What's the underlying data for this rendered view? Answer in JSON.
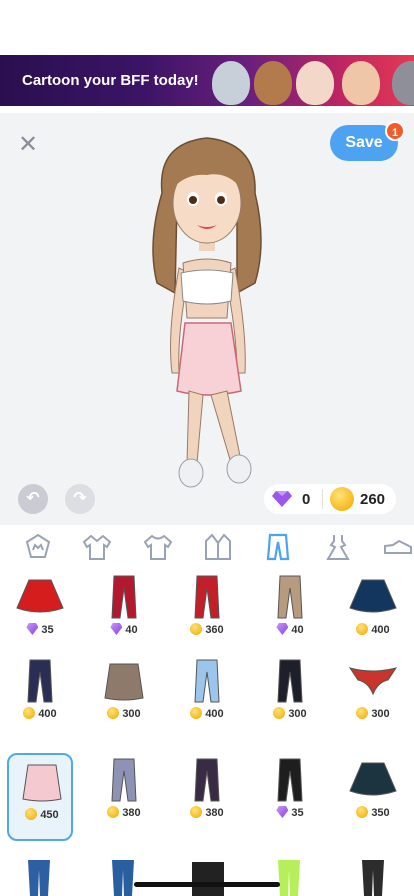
{
  "ad": {
    "text": "Cartoon your BFF today!"
  },
  "header": {
    "save_label": "Save",
    "save_badge": "1"
  },
  "wallet": {
    "gems": "0",
    "coins": "260"
  },
  "categories": [
    "crown-icon",
    "jacket-icon",
    "shirt-icon",
    "coat-icon",
    "pants-icon",
    "dress-icon",
    "shoe-icon"
  ],
  "active_category": "pants-icon",
  "colors": {
    "accent": "#4da3f2",
    "badge": "#f25a2a",
    "stage": "#f2f3f5"
  },
  "items": [
    {
      "name": "red-skirt",
      "price": "35",
      "currency": "gem",
      "color": "#d61d1d",
      "shape": "skirt"
    },
    {
      "name": "red-plaid-pants",
      "price": "40",
      "currency": "gem",
      "color": "#b3182e",
      "shape": "pants"
    },
    {
      "name": "red-pants",
      "price": "360",
      "currency": "coin",
      "color": "#c21f2a",
      "shape": "pants"
    },
    {
      "name": "tan-pants",
      "price": "40",
      "currency": "gem",
      "color": "#b69b7f",
      "shape": "pants"
    },
    {
      "name": "navy-skirt",
      "price": "400",
      "currency": "coin",
      "color": "#12365e",
      "shape": "skirt"
    },
    {
      "name": "navy-pants",
      "price": "400",
      "currency": "coin",
      "color": "#2a2e55",
      "shape": "pants"
    },
    {
      "name": "snake-skirt",
      "price": "300",
      "currency": "coin",
      "color": "#8d7a6a",
      "shape": "miniskirt"
    },
    {
      "name": "light-jeans",
      "price": "400",
      "currency": "coin",
      "color": "#9cc5ec",
      "shape": "pants"
    },
    {
      "name": "black-cargo",
      "price": "300",
      "currency": "coin",
      "color": "#1d1f2a",
      "shape": "pants"
    },
    {
      "name": "gold-bikini",
      "price": "300",
      "currency": "coin",
      "color": "#c9342b",
      "shape": "bikini"
    },
    {
      "name": "pink-skirt",
      "price": "450",
      "currency": "coin",
      "color": "#f4c9cf",
      "shape": "miniskirt",
      "selected": true
    },
    {
      "name": "grey-leggings",
      "price": "380",
      "currency": "coin",
      "color": "#8e93b5",
      "shape": "pants"
    },
    {
      "name": "purple-leggings",
      "price": "380",
      "currency": "coin",
      "color": "#3a2b44",
      "shape": "pants"
    },
    {
      "name": "moto-leggings",
      "price": "35",
      "currency": "gem",
      "color": "#1e1e1e",
      "shape": "pants"
    },
    {
      "name": "teal-skirt",
      "price": "350",
      "currency": "coin",
      "color": "#1c3440",
      "shape": "skirt"
    }
  ]
}
